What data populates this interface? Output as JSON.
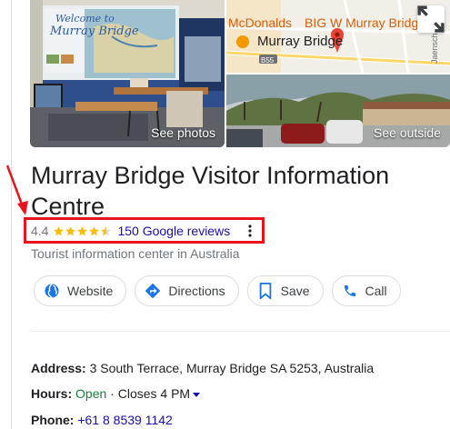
{
  "photos": {
    "main_label": "See photos",
    "outside_label": "See outside",
    "map": {
      "label_mcdonalds": "McDonalds",
      "label_bigw": "BIG W Murray Bridge",
      "label_place": "Murray Bridge",
      "label_road": "B55",
      "label_street": "Jaensch"
    },
    "photo_text": {
      "sign_line1": "Welcome to",
      "sign_line2": "Murray Bridge"
    }
  },
  "place": {
    "title": "Murray Bridge Visitor Information Centre",
    "rating": "4.4",
    "rating_value": 4.4,
    "rating_max": 5,
    "reviews": "150 Google reviews",
    "category": "Tourist information center in Australia"
  },
  "actions": [
    {
      "label": "Website",
      "icon": "globe-icon"
    },
    {
      "label": "Directions",
      "icon": "directions-icon"
    },
    {
      "label": "Save",
      "icon": "bookmark-icon"
    },
    {
      "label": "Call",
      "icon": "phone-icon"
    }
  ],
  "details": {
    "address_label": "Address:",
    "address_value": "3 South Terrace, Murray Bridge SA 5253, Australia",
    "hours_label": "Hours:",
    "hours_status": "Open",
    "hours_separator": "·",
    "hours_close": "Closes 4 PM",
    "phone_label": "Phone:",
    "phone_value": "+61 8 8539 1142"
  },
  "colors": {
    "highlight_box": "#e8141b",
    "star": "#fbbc04",
    "link": "#1a0dab",
    "open": "#188038",
    "map_pin": "#ea4335"
  }
}
